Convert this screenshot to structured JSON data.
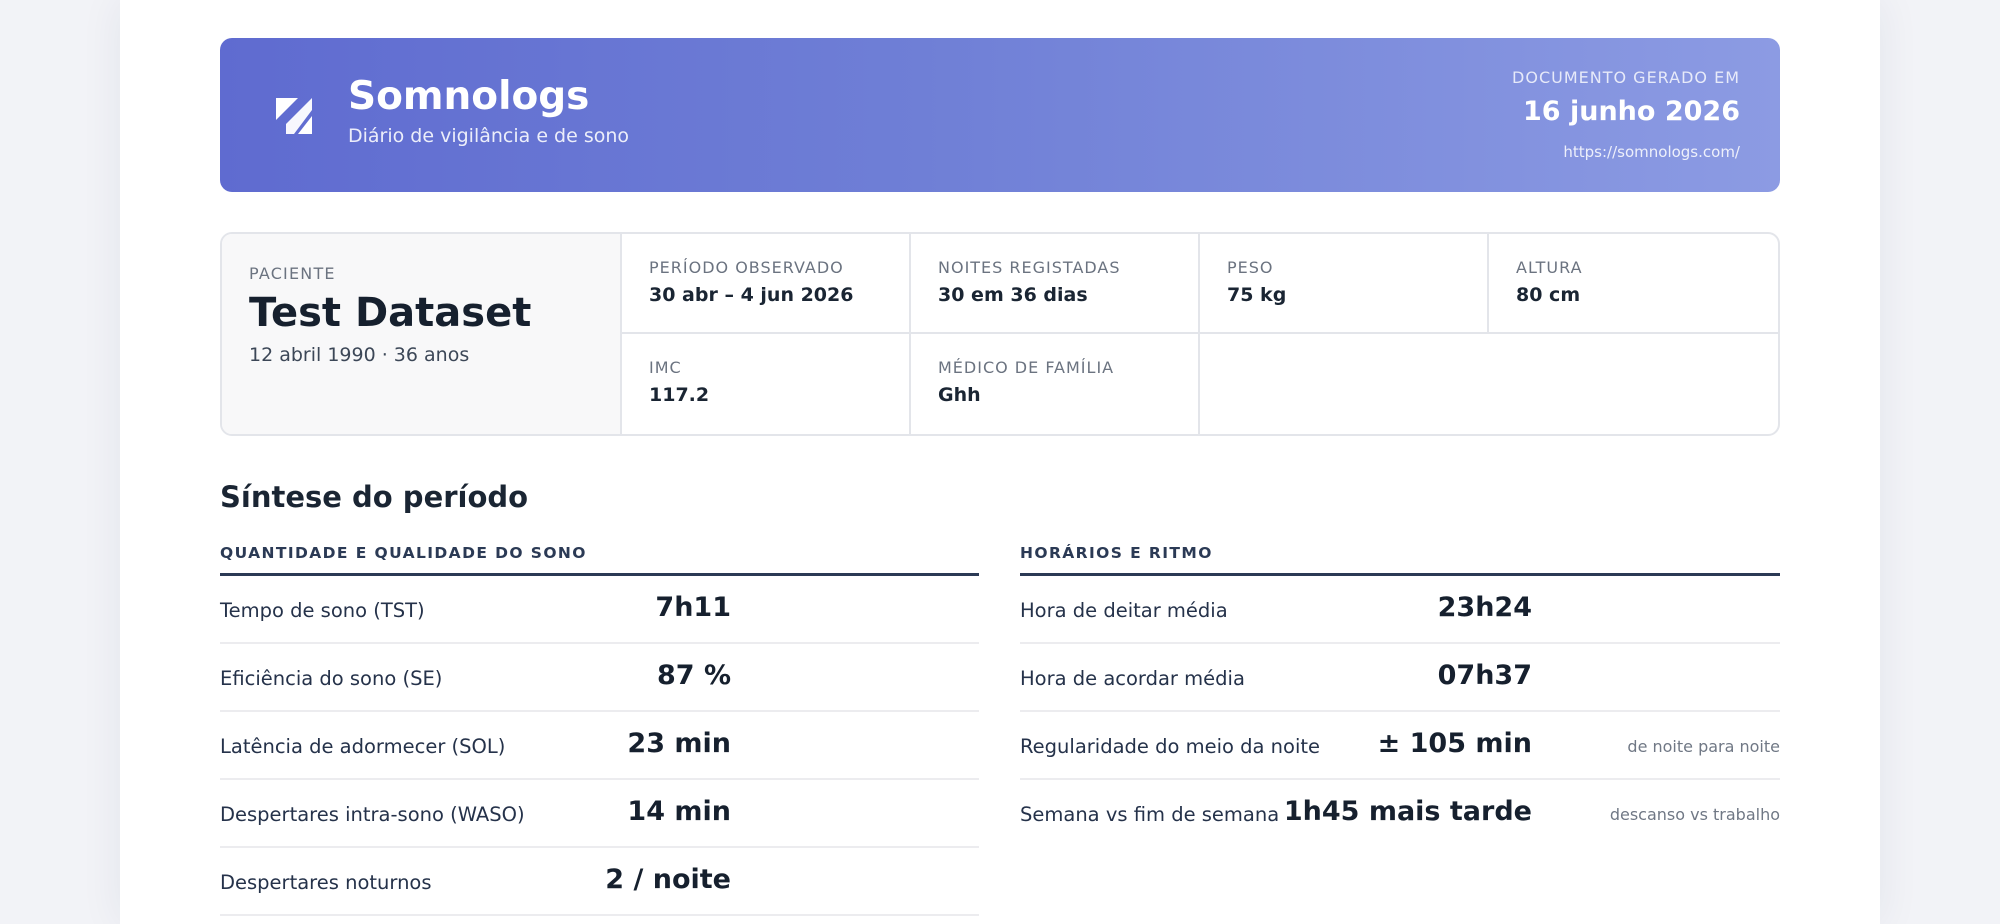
{
  "header": {
    "brand_name": "Somnologs",
    "brand_subtitle": "Diário de vigilância e de sono",
    "generated_label": "DOCUMENTO GERADO EM",
    "generated_date": "16 junho 2026",
    "url": "https://somnologs.com/",
    "logo_icon": "somnologs-logo-icon"
  },
  "patient": {
    "label": "PACIENTE",
    "name": "Test Dataset",
    "dob_age": "12 abril 1990 · 36 anos",
    "fields": [
      {
        "label": "PERÍODO OBSERVADO",
        "value": "30 abr – 4 jun 2026"
      },
      {
        "label": "NOITES REGISTADAS",
        "value": "30 em 36 dias"
      },
      {
        "label": "PESO",
        "value": "75 kg"
      },
      {
        "label": "ALTURA",
        "value": "80 cm"
      },
      {
        "label": "IMC",
        "value": "117.2"
      },
      {
        "label": "MÉDICO DE FAMÍLIA",
        "value": "Ghh"
      }
    ]
  },
  "summary": {
    "title": "Síntese do período",
    "left": {
      "heading": "QUANTIDADE E QUALIDADE DO SONO",
      "rows": [
        {
          "label": "Tempo de sono (TST)",
          "value": "7h11"
        },
        {
          "label": "Eficiência do sono (SE)",
          "value": "87 %"
        },
        {
          "label": "Latência de adormecer (SOL)",
          "value": "23 min"
        },
        {
          "label": "Despertares intra-sono (WASO)",
          "value": "14 min"
        },
        {
          "label": "Despertares noturnos",
          "value": "2 / noite"
        }
      ]
    },
    "right": {
      "heading": "HORÁRIOS E RITMO",
      "rows": [
        {
          "label": "Hora de deitar média",
          "value": "23h24",
          "note": ""
        },
        {
          "label": "Hora de acordar média",
          "value": "07h37",
          "note": ""
        },
        {
          "label": "Regularidade do meio da noite",
          "value": "± 105 min",
          "note": "de noite para noite"
        },
        {
          "label": "Semana vs fim de semana",
          "value": "1h45 mais tarde",
          "note": "descanso vs trabalho"
        }
      ]
    }
  },
  "colors": {
    "banner_start": "#5f6bd0",
    "banner_end": "#8c9be3",
    "heading_rule": "#2b3a55"
  }
}
